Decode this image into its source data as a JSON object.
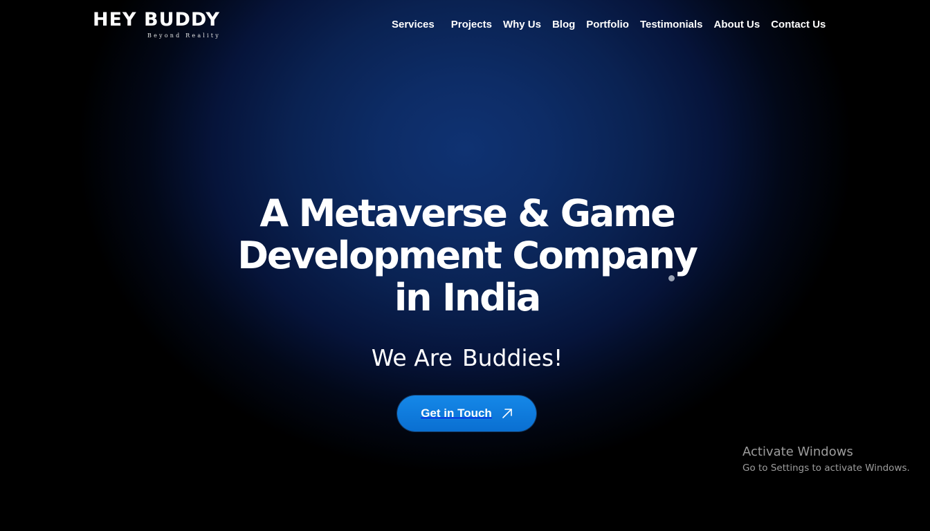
{
  "brand": {
    "name": "HEY BUDDY",
    "tagline": "Beyond Reality"
  },
  "nav": {
    "items": [
      {
        "label": "Services"
      },
      {
        "label": "Projects"
      },
      {
        "label": "Why Us"
      },
      {
        "label": "Blog"
      },
      {
        "label": "Portfolio"
      },
      {
        "label": "Testimonials"
      },
      {
        "label": "About Us"
      },
      {
        "label": "Contact Us"
      }
    ]
  },
  "hero": {
    "title": "A Metaverse & Game Development Company in India",
    "subtitle_part1": "We Are",
    "subtitle_part2": "Buddies!",
    "cta_label": "Get in Touch",
    "cta_icon": "arrow-up-right-icon"
  },
  "watermark": {
    "title": "Activate Windows",
    "subtitle": "Go to Settings to activate Windows."
  },
  "colors": {
    "background": "#000000",
    "hero_glow": "#0f3272",
    "cta": "#0a74d8",
    "text": "#ffffff"
  }
}
